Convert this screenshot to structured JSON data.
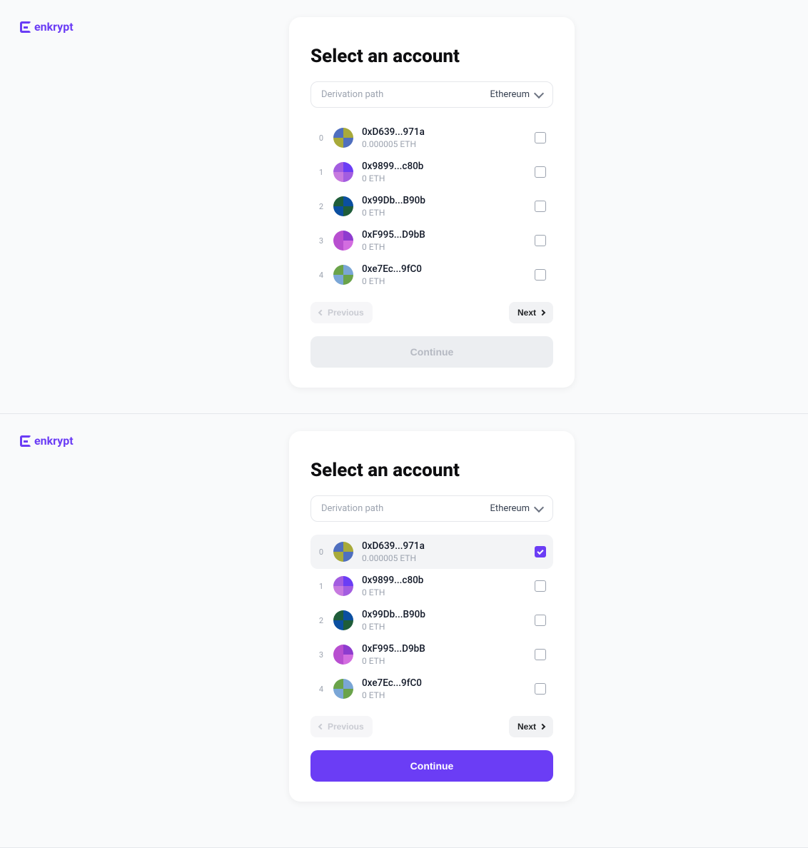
{
  "brand": "enkrypt",
  "panels": [
    {
      "title": "Select an account",
      "derivation": {
        "label": "Derivation path",
        "value": "Ethereum"
      },
      "accounts": [
        {
          "index": "0",
          "address": "0xD639...971a",
          "balance": "0.000005 ETH",
          "checked": false,
          "colors": [
            "#4f6fbf",
            "#a8aa3a",
            "#a8aa3a",
            "#4f6fbf"
          ]
        },
        {
          "index": "1",
          "address": "0x9899...c80b",
          "balance": "0 ETH",
          "checked": false,
          "colors": [
            "#a35de0",
            "#6b3df5",
            "#c77adf",
            "#a35de0"
          ]
        },
        {
          "index": "2",
          "address": "0x99Db...B90b",
          "balance": "0 ETH",
          "checked": false,
          "colors": [
            "#1f5d3a",
            "#0b4fa0",
            "#0b4fa0",
            "#1f5d3a"
          ]
        },
        {
          "index": "3",
          "address": "0xF995...D9bB",
          "balance": "0 ETH",
          "checked": false,
          "colors": [
            "#b84fd0",
            "#8e3ccf",
            "#b84fd0",
            "#d36de0"
          ]
        },
        {
          "index": "4",
          "address": "0xe7Ec...9fC0",
          "balance": "0 ETH",
          "checked": false,
          "colors": [
            "#6aa34a",
            "#7aa6d6",
            "#7aa6d6",
            "#6aa34a"
          ]
        }
      ],
      "pager": {
        "prev": "Previous",
        "prevDisabled": true,
        "next": "Next"
      },
      "continueLabel": "Continue",
      "continueEnabled": false
    },
    {
      "title": "Select an account",
      "derivation": {
        "label": "Derivation path",
        "value": "Ethereum"
      },
      "accounts": [
        {
          "index": "0",
          "address": "0xD639...971a",
          "balance": "0.000005 ETH",
          "checked": true,
          "colors": [
            "#4f6fbf",
            "#a8aa3a",
            "#a8aa3a",
            "#4f6fbf"
          ]
        },
        {
          "index": "1",
          "address": "0x9899...c80b",
          "balance": "0 ETH",
          "checked": false,
          "colors": [
            "#a35de0",
            "#6b3df5",
            "#c77adf",
            "#a35de0"
          ]
        },
        {
          "index": "2",
          "address": "0x99Db...B90b",
          "balance": "0 ETH",
          "checked": false,
          "colors": [
            "#1f5d3a",
            "#0b4fa0",
            "#0b4fa0",
            "#1f5d3a"
          ]
        },
        {
          "index": "3",
          "address": "0xF995...D9bB",
          "balance": "0 ETH",
          "checked": false,
          "colors": [
            "#b84fd0",
            "#8e3ccf",
            "#b84fd0",
            "#d36de0"
          ]
        },
        {
          "index": "4",
          "address": "0xe7Ec...9fC0",
          "balance": "0 ETH",
          "checked": false,
          "colors": [
            "#6aa34a",
            "#7aa6d6",
            "#7aa6d6",
            "#6aa34a"
          ]
        }
      ],
      "pager": {
        "prev": "Previous",
        "prevDisabled": true,
        "next": "Next"
      },
      "continueLabel": "Continue",
      "continueEnabled": true
    }
  ]
}
